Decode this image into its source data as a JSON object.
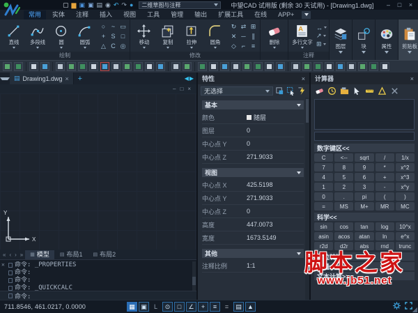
{
  "title_bar": {
    "workspace": "二维草图与注释",
    "title": "中望CAD 试用版 (剩余 30 天试用) - [Drawing1.dwg]",
    "controls": {
      "minimize": "–",
      "maximize": "□",
      "close": "×"
    }
  },
  "quick_access": {
    "icons": [
      "new-file-icon",
      "open-folder-icon",
      "save-icon",
      "save-as-icon",
      "plot-icon",
      "preview-icon",
      "undo-icon",
      "redo-icon",
      "online-icon"
    ]
  },
  "menu_tabs": {
    "items": [
      "常用",
      "实体",
      "注释",
      "插入",
      "视图",
      "工具",
      "管理",
      "输出",
      "扩展工具",
      "在线",
      "APP+"
    ],
    "active_index": 0
  },
  "ribbon": {
    "groups": [
      {
        "label": "绘制",
        "big": [
          {
            "label": "直线",
            "icon": "line-icon"
          },
          {
            "label": "多段线",
            "icon": "polyline-icon"
          },
          {
            "label": "圆",
            "icon": "circle-icon"
          },
          {
            "label": "圆弧",
            "icon": "arc-icon"
          }
        ],
        "small": [
          "ellipse-icon",
          "spline-icon",
          "rectangle-icon",
          "point-icon",
          "sketch-icon",
          "region-icon",
          "hatch-icon",
          "revcloud-icon",
          "donut-icon"
        ]
      },
      {
        "label": "修改",
        "big": [
          {
            "label": "移动",
            "icon": "move-icon"
          },
          {
            "label": "复制",
            "icon": "copy-icon"
          },
          {
            "label": "拉伸",
            "icon": "stretch-icon"
          },
          {
            "label": "圆角",
            "icon": "fillet-icon"
          }
        ],
        "small": [
          "rotate-icon",
          "mirror-icon",
          "scale-icon",
          "trim-icon",
          "erase-small-icon",
          "offset-icon",
          "array-icon",
          "explode-icon",
          "break-icon"
        ]
      },
      {
        "label": "",
        "big": [
          {
            "label": "删除",
            "icon": "eraser-icon"
          }
        ],
        "small": []
      },
      {
        "label": "注释",
        "big": [
          {
            "label": "多行文字",
            "icon": "mtext-icon"
          }
        ],
        "small": [
          "dimension-icon",
          "leader-icon",
          "table-icon"
        ]
      }
    ],
    "tall_buttons": [
      {
        "label": "图层",
        "icon": "layers-icon"
      },
      {
        "label": "块",
        "icon": "block-icon"
      },
      {
        "label": "属性",
        "icon": "palette-icon"
      },
      {
        "label": "剪贴板",
        "icon": "clipboard-icon"
      }
    ]
  },
  "quick_toolbar": {
    "clusters": [
      2,
      2,
      10,
      2,
      8,
      9
    ]
  },
  "document_tabs": {
    "tabs": [
      {
        "label": "Drawing1.dwg",
        "active": true
      }
    ]
  },
  "drawing_window": {
    "controls": {
      "minimize": "–",
      "restore": "□",
      "close": "×"
    }
  },
  "layout_bar": {
    "nav": [
      "«",
      "‹",
      "›",
      "»"
    ],
    "tabs": [
      "模型",
      "布局1",
      "布局2"
    ],
    "active_index": 0
  },
  "command_window": {
    "history": [
      "命令: _PROPERTIES",
      "命令:",
      "命令:",
      "命令: _QUICKCALC"
    ],
    "current": "命令:"
  },
  "status_bar": {
    "coordinates": "711.8546, 461.0217, 0.0000",
    "toggles": [
      {
        "name": "grid",
        "glyph": "▦",
        "state": "active"
      },
      {
        "name": "snap",
        "glyph": "▣",
        "state": "on"
      },
      {
        "name": "ortho",
        "glyph": "L",
        "state": "off"
      },
      {
        "name": "polar",
        "glyph": "⊙",
        "state": "on"
      },
      {
        "name": "osnap",
        "glyph": "□",
        "state": "on"
      },
      {
        "name": "otrack",
        "glyph": "∠",
        "state": "on"
      },
      {
        "name": "dyn",
        "glyph": "+",
        "state": "on"
      },
      {
        "name": "lineweight",
        "glyph": "≡",
        "state": "on"
      },
      {
        "name": "equals",
        "glyph": "=",
        "state": "plain"
      },
      {
        "name": "model",
        "glyph": "▤",
        "state": "on"
      },
      {
        "name": "annotation",
        "glyph": "▲",
        "state": "on"
      }
    ]
  },
  "properties_panel": {
    "title": "特性",
    "close": "×",
    "selection": "无选择",
    "toolbar_icons": [
      "pickadd-toggle-icon",
      "select-objects-icon",
      "quick-select-icon"
    ],
    "sections": [
      {
        "header": "基本",
        "rows": [
          {
            "label": "颜色",
            "value": "随层",
            "swatch": "#e8e8e8"
          },
          {
            "label": "图层",
            "value": "0"
          },
          {
            "label": "中心点 Y",
            "value": "0"
          },
          {
            "label": "中心点 Z",
            "value": "271.9033"
          }
        ]
      },
      {
        "header": "视图",
        "rows": [
          {
            "label": "中心点 X",
            "value": "425.5198"
          },
          {
            "label": "中心点 Y",
            "value": "271.9033"
          },
          {
            "label": "中心点 Z",
            "value": "0"
          },
          {
            "label": "高度",
            "value": "447.0073"
          },
          {
            "label": "宽度",
            "value": "1673.5149"
          }
        ]
      },
      {
        "header": "其他",
        "rows": [
          {
            "label": "注释比例",
            "value": "1:1"
          }
        ]
      }
    ]
  },
  "calculator_panel": {
    "title": "计算器",
    "close": "×",
    "toolbar_icons": [
      "clear-icon",
      "history-icon",
      "paste-icon",
      "get-point-icon",
      "measure-distance-icon",
      "measure-angle-icon",
      "delete-icon"
    ],
    "display_value": "",
    "input_value": "",
    "numpad_header": "数字键区<<",
    "numpad": [
      [
        "C",
        "<--",
        "sqrt",
        "/",
        "1/x"
      ],
      [
        "7",
        "8",
        "9",
        "*",
        "x^2"
      ],
      [
        "4",
        "5",
        "6",
        "+",
        "x^3"
      ],
      [
        "1",
        "2",
        "3",
        "-",
        "x^y"
      ],
      [
        "0",
        ".",
        "pi",
        "(",
        ")"
      ],
      [
        "=",
        "MS",
        "M+",
        "MR",
        "MC"
      ]
    ],
    "scientific_header": "科学<<",
    "scientific": [
      [
        "sin",
        "cos",
        "tan",
        "log",
        "10^x"
      ],
      [
        "asin",
        "acos",
        "atan",
        "ln",
        "e^x"
      ],
      [
        "r2d",
        "d2r",
        "abs",
        "rnd",
        "trunc"
      ]
    ],
    "collapsed_sections": [
      "单位转换>>",
      "变量>>",
      "文本计算>>"
    ]
  },
  "watermark": {
    "line1": "脚本之家",
    "line2": "www.jb51.net",
    "color": "#cf1313"
  },
  "ucs": {
    "x_label": "X",
    "y_label": "Y"
  }
}
